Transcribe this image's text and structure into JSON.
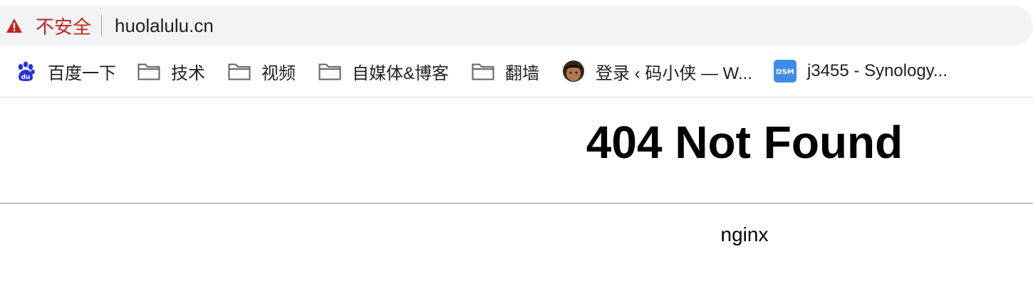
{
  "address_bar": {
    "security_label": "不安全",
    "url": "huolalulu.cn",
    "security_color": "#c5221f"
  },
  "bookmarks": [
    {
      "label": "百度一下",
      "icon": "baidu-paw-icon"
    },
    {
      "label": "技术",
      "icon": "folder-icon"
    },
    {
      "label": "视频",
      "icon": "folder-icon"
    },
    {
      "label": "自媒体&博客",
      "icon": "folder-icon"
    },
    {
      "label": "翻墙",
      "icon": "folder-icon"
    },
    {
      "label": "登录 ‹ 码小侠 — W...",
      "icon": "avatar-icon"
    },
    {
      "label": "j3455 - Synology...",
      "icon": "dsm-icon"
    }
  ],
  "page": {
    "title": "404 Not Found",
    "server": "nginx"
  }
}
